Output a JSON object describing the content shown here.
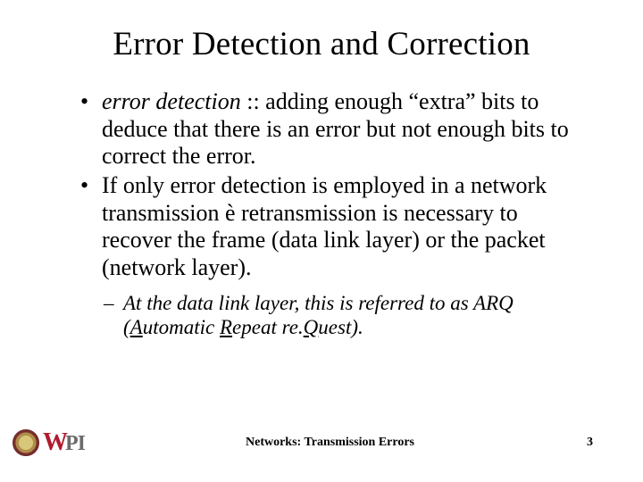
{
  "title": "Error Detection and Correction",
  "bullets": [
    {
      "term": "error detection",
      "rest": " :: adding enough “extra” bits to deduce that there is an error but not enough bits to correct the error."
    },
    {
      "full": "If only error detection is employed in a network transmission è retransmission is necessary to recover the frame (data link layer) or the packet (network layer)."
    }
  ],
  "sub": {
    "prefix": "At the data link layer, this is referred to as ",
    "arq": "ARQ",
    "open_paren": "(",
    "a_letter": "A",
    "a_rest": "utomatic ",
    "r_letter": "R",
    "r_rest": "epeat re.",
    "q_letter": "Q",
    "q_rest": "uest)."
  },
  "footer": {
    "label": "Networks: Transmission Errors",
    "page": "3"
  },
  "logo": {
    "w": "W",
    "pi": "PI"
  }
}
